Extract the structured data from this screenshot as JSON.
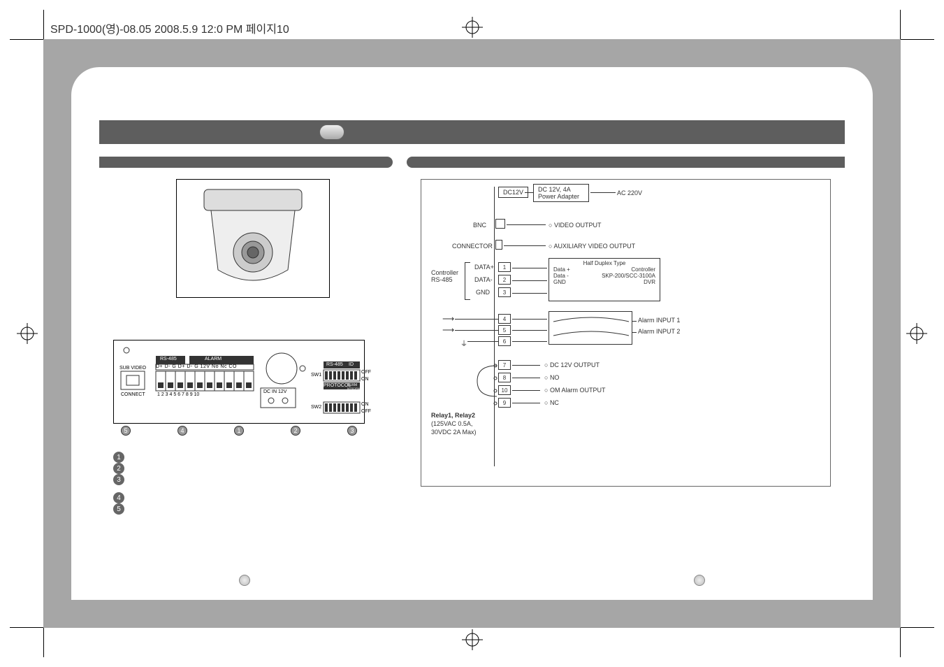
{
  "header": {
    "imposition_text": "SPD-1000(영)-08.05  2008.5.9 12:0 PM  페이지10"
  },
  "right_diagram": {
    "power": {
      "dc12v": "DC12V",
      "adapter_line1": "DC 12V, 4A",
      "adapter_line2": "Power Adapter",
      "ac220v": "AC 220V"
    },
    "bnc": {
      "label": "BNC",
      "out": "VIDEO OUTPUT"
    },
    "connector": {
      "label": "CONNECTOR",
      "out": "AUXILIARY VIDEO OUTPUT"
    },
    "rs485": {
      "group_label": "Controller\nRS-485",
      "pins": [
        {
          "name": "DATA+",
          "num": "1"
        },
        {
          "name": "DATA-",
          "num": "2"
        },
        {
          "name": "GND",
          "num": "3"
        }
      ],
      "right_block": {
        "title": "Half Duplex Type",
        "rows": [
          {
            "l": "Data +",
            "r": "Controller"
          },
          {
            "l": "Data -",
            "r": "SKP-200/SCC-3100A"
          },
          {
            "l": "GND",
            "r": "DVR"
          }
        ]
      }
    },
    "alarm_in": {
      "pins": [
        "4",
        "5",
        "6"
      ],
      "labels": [
        "Alarm INPUT 1",
        "Alarm INPUT 2"
      ]
    },
    "outputs": {
      "rows": [
        {
          "num": "7",
          "label": "DC 12V OUTPUT"
        },
        {
          "num": "8",
          "label": "NO"
        },
        {
          "num": "10",
          "label": "OM Alarm OUTPUT"
        },
        {
          "num": "9",
          "label": "NC"
        }
      ]
    },
    "relay_note": {
      "l1": "Relay1, Relay2",
      "l2": "(125VAC 0.5A,",
      "l3": "30VDC 2A Max)"
    }
  },
  "board_labels": {
    "sub_video": "SUB VIDEO",
    "connect": "CONNECT",
    "rs485": "RS-485",
    "alarm": "ALARM",
    "dcin": "DC IN 12V",
    "sw1": "SW1",
    "sw2": "SW2",
    "id": "ID",
    "protocol": "PROTOCOL",
    "term": "TERM",
    "ntsc_pal": "NTSC/PAL",
    "scale": "1  2  3  4  5  6  7  8  9  10",
    "onoff_top": "OFF",
    "onoff_top2": "ON",
    "onoff_bot": "ON",
    "onoff_bot2": "OFF",
    "rs_cols": "D+ D-  G   D+ D-  G   12V  No  Nc  CO"
  },
  "callouts": [
    "1",
    "2",
    "3",
    "4",
    "5"
  ]
}
